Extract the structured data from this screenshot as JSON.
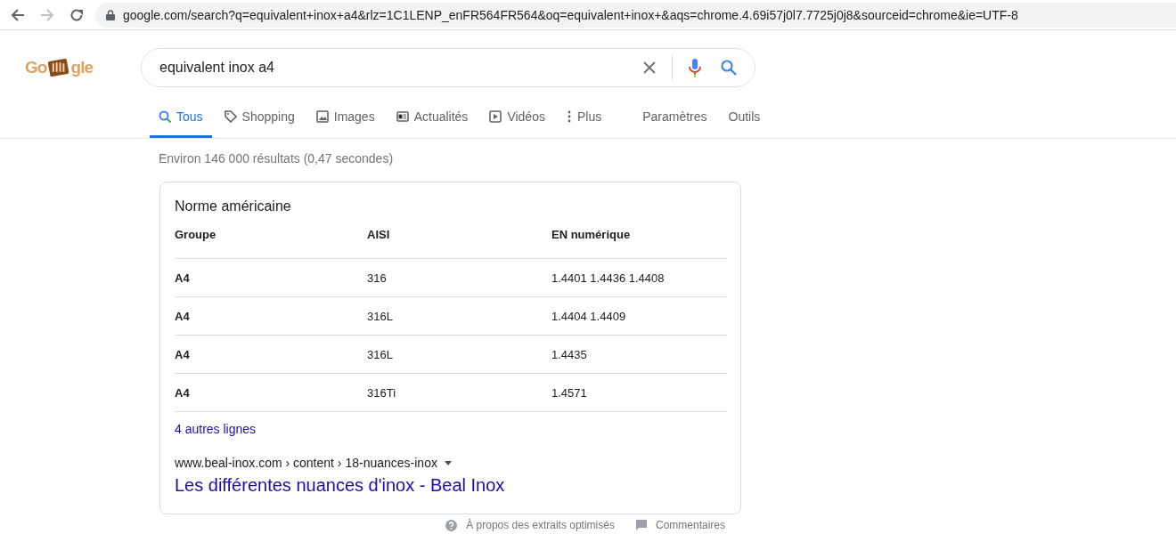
{
  "browser": {
    "url": "google.com/search?q=equivalent+inox+a4&rlz=1C1LENP_enFR564FR564&oq=equivalent+inox+&aqs=chrome.4.69i57j0l7.7725j0j8&sourceid=chrome&ie=UTF-8"
  },
  "logo": {
    "parts": [
      "Go",
      "gle"
    ]
  },
  "search": {
    "value": "equivalent inox a4"
  },
  "tabs": [
    {
      "label": "Tous",
      "kind": "search",
      "selected": true
    },
    {
      "label": "Shopping",
      "kind": "tag",
      "selected": false
    },
    {
      "label": "Images",
      "kind": "image",
      "selected": false
    },
    {
      "label": "Actualités",
      "kind": "news",
      "selected": false
    },
    {
      "label": "Vidéos",
      "kind": "video",
      "selected": false
    },
    {
      "label": "Plus",
      "kind": "more",
      "selected": false
    }
  ],
  "tools": [
    "Paramètres",
    "Outils"
  ],
  "result_stats": "Environ 146 000 résultats (0,47 secondes)",
  "snippet": {
    "title": "Norme américaine",
    "table": {
      "columns": [
        "Groupe",
        "AISI",
        "EN numérique"
      ],
      "rows": [
        [
          "A4",
          "316",
          "1.4401 1.4436 1.4408"
        ],
        [
          "A4",
          "316L",
          "1.4404 1.4409"
        ],
        [
          "A4",
          "316L",
          "1.4435"
        ],
        [
          "A4",
          "316Ti",
          "1.4571"
        ]
      ]
    },
    "more_link": "4 autres lignes",
    "breadcrumb": "www.beal-inox.com › content › 18-nuances-inox",
    "link_title": "Les différentes nuances d'inox - Beal Inox"
  },
  "footer": [
    "À propos des extraits optimisés",
    "Commentaires"
  ]
}
